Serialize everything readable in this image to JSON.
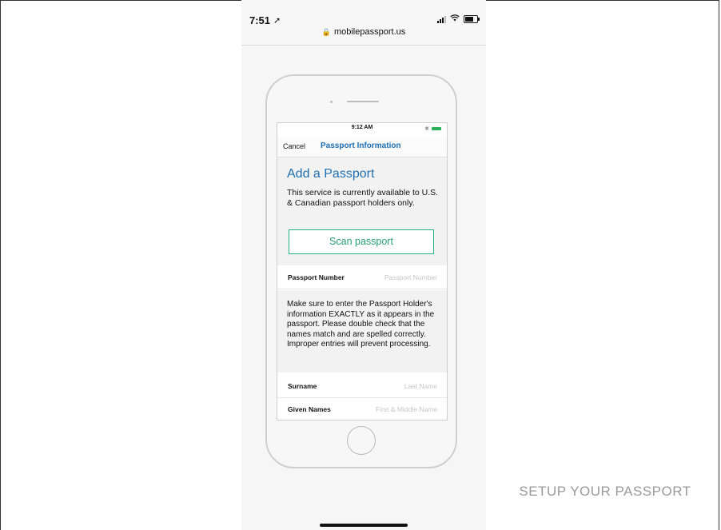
{
  "status_bar": {
    "time": "7:51",
    "url": "mobilepassport.us"
  },
  "phone_screen": {
    "status_time": "9:12 AM",
    "nav": {
      "cancel": "Cancel",
      "title": "Passport Information"
    },
    "heading": "Add a Passport",
    "description": "This service is currently available to U.S. & Canadian passport holders only.",
    "scan_button": "Scan passport",
    "fields": [
      {
        "label": "Passport Number",
        "placeholder": "Passport Number"
      },
      {
        "label": "Surname",
        "placeholder": "Last Name"
      },
      {
        "label": "Given Names",
        "placeholder": "First & Middle Name"
      }
    ],
    "notice": "Make sure to enter the Passport Holder's information EXACTLY as it appears in the passport.  Please double check that the names match and are spelled correctly. Improper entries will prevent processing."
  },
  "caption": "SETUP YOUR PASSPORT",
  "colors": {
    "accent_blue": "#1f6fb2",
    "scan_green": "#27a06e"
  },
  "icons": [
    "location-arrow-icon",
    "signal-icon",
    "wifi-icon",
    "battery-icon",
    "lock-icon",
    "bluetooth-icon"
  ]
}
